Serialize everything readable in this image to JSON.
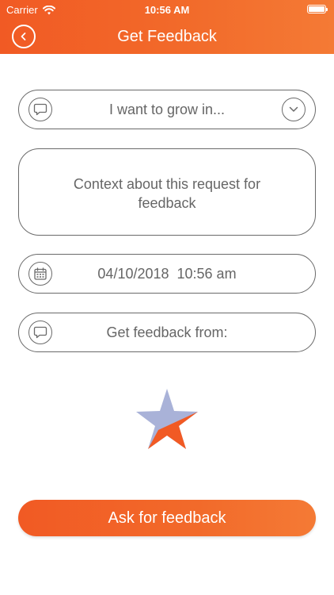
{
  "status_bar": {
    "carrier": "Carrier",
    "time": "10:56 AM"
  },
  "header": {
    "title": "Get Feedback"
  },
  "form": {
    "grow_placeholder": "I want to grow in...",
    "context_placeholder": "Context about this request for feedback",
    "date_value": "04/10/2018  10:56 am",
    "from_placeholder": "Get feedback from:"
  },
  "actions": {
    "ask_label": "Ask for feedback"
  },
  "colors": {
    "accent": "#f15a24",
    "accent_light": "#f47a35",
    "star_blue": "#a9b2d8",
    "star_orange": "#f15a24",
    "outline": "#6a6a6a"
  },
  "icons": {
    "back": "chevron-left-icon",
    "comment": "speech-bubble-icon",
    "dropdown": "chevron-down-icon",
    "calendar": "calendar-icon",
    "logo": "star-logo"
  }
}
